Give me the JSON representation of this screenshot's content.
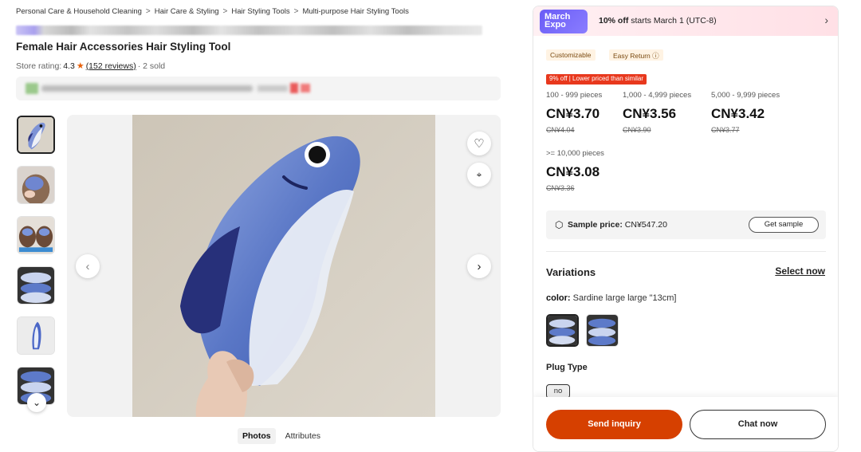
{
  "breadcrumb": [
    "Personal Care & Household Cleaning",
    "Hair Care & Styling",
    "Hair Styling Tools",
    "Multi-purpose Hair Styling Tools"
  ],
  "breadcrumb_sep": ">",
  "product": {
    "title": "Female Hair Accessories Hair Styling Tool",
    "rating_label": "Store rating:",
    "rating_value": "4.3",
    "reviews": "(152 reviews)",
    "sold": "· 2 sold"
  },
  "gallery": {
    "thumb_count": 6,
    "tabs": [
      "Photos",
      "Attributes"
    ],
    "active_tab": "Photos"
  },
  "promo": {
    "logo_line1": "March",
    "logo_line2": "Expo",
    "text_bold": "10% off",
    "text_rest": " starts March 1 (UTC-8)"
  },
  "tags": [
    "Customizable",
    "Easy Return ⓘ"
  ],
  "price_tag": "9% off  |  Lower priced than similar",
  "tiers": [
    {
      "qty": "100 - 999 pieces",
      "price": "CN¥3.70",
      "orig": "CN¥4.04"
    },
    {
      "qty": "1,000 - 4,999 pieces",
      "price": "CN¥3.56",
      "orig": "CN¥3.90"
    },
    {
      "qty": "5,000 - 9,999 pieces",
      "price": "CN¥3.42",
      "orig": "CN¥3.77"
    },
    {
      "qty": ">= 10,000 pieces",
      "price": "CN¥3.08",
      "orig": "CN¥3.36"
    }
  ],
  "sample": {
    "label": "Sample price:",
    "price": "CN¥547.20",
    "button": "Get sample"
  },
  "variations": {
    "title": "Variations",
    "select_now": "Select now",
    "color_label": "color:",
    "color_value": "Sardine large large \"13cm]",
    "plug_title": "Plug Type",
    "plug_option": "no"
  },
  "actions": {
    "send": "Send inquiry",
    "chat": "Chat now"
  },
  "colors": {
    "accent": "#d64000",
    "promo_logo": "#6a5cf6",
    "offtag": "#e8381d",
    "star": "#e8600a"
  }
}
